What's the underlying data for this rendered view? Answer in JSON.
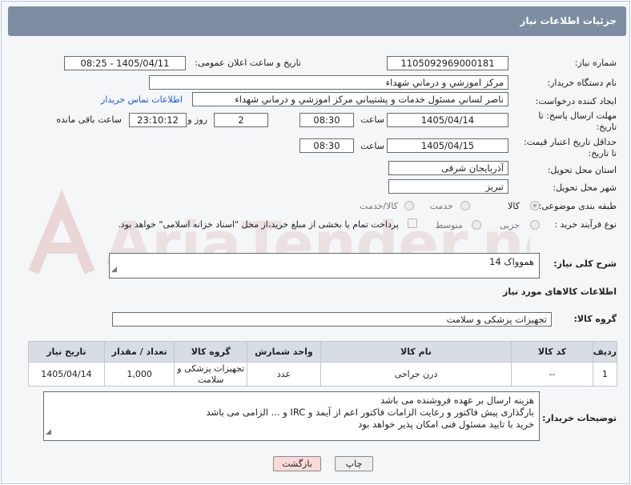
{
  "header": {
    "title": "جزئیات اطلاعات نیاز"
  },
  "form": {
    "need_number_label": "شماره نیاز:",
    "need_number": "1105092969000181",
    "announce_label": "تاریخ و ساعت اعلان عمومی:",
    "announce_value": "1405/04/11 - 08:25",
    "buyer_org_label": "نام دستگاه خریدار:",
    "buyer_org": "مرکز اموزشي و درماني شهداء",
    "requester_label": "ایجاد کننده درخواست:",
    "requester": "ناصر لساني مسئول خدمات و پشتيباني مرکز اموزشي و درماني شهداء",
    "contact_link": "اطلاعات تماس خریدار",
    "deadline_label_1": "مهلت ارسال پاسخ: تا",
    "deadline_label_2": "تاریخ:",
    "deadline_date": "1405/04/14",
    "hour_label": "ساعت",
    "deadline_time": "08:30",
    "days_value": "2",
    "days_label": "روز و",
    "remaining_time": "23:10:12",
    "remaining_label": "ساعت باقی مانده",
    "validity_label_1": "حداقل تاریخ اعتبار قیمت:",
    "validity_label_2": "تا تاریخ:",
    "validity_date": "1405/04/15",
    "validity_time": "08:30",
    "province_label": "استان محل تحویل:",
    "province": "آذربایجان شرقی",
    "city_label": "شهر محل تحویل:",
    "city": "تبریز",
    "category_label": "طبقه بندی موضوعی:",
    "category_options": [
      "کالا",
      "خدمت",
      "کالا/خدمت"
    ],
    "process_label": "نوع فرآیند خرید :",
    "process_options": [
      "جزیی",
      "متوسط"
    ],
    "payment_note": "پرداخت تمام یا بخشی از مبلغ خرید،از محل \"اسناد خزانه اسلامی\" خواهد بود.",
    "summary_label": "شرح کلی نیاز:",
    "summary": "هموواک 14",
    "items_section_label": "اطلاعات کالاهای مورد نیاز",
    "goods_group_label": "گروه کالا:",
    "goods_group": "تجهیزات پزشکی و سلامت"
  },
  "table": {
    "columns": [
      "ردیف",
      "کد کالا",
      "نام کالا",
      "واحد شمارش",
      "گروه کالا",
      "تعداد / مقدار",
      "تاریخ نیاز"
    ],
    "rows": [
      [
        "1",
        "--",
        "درن جراحی",
        "عدد",
        "تجهیزات پزشکی و سلامت",
        "1,000",
        "1405/04/14"
      ]
    ]
  },
  "buyer_notes": {
    "label": "توضیحات خریدار:",
    "line1": "هزینه ارسال بر عهده فروشنده می باشد",
    "line2": "بارگذاری پیش فاکتور و رعایت الزامات فاکتور اعم از آیمد و IRC  و ... الزامی می باشد",
    "line3": "خرید با تایید مسئول فنی امکان پذیر خواهد بود"
  },
  "buttons": {
    "print": "چاپ",
    "back": "بازگشت"
  },
  "watermark": {
    "text": "AriaTender.neT"
  },
  "colors": {
    "header_bg": "#7d8ea3",
    "link": "#1a5cc8",
    "back_button_bg": "#f9d9d9",
    "table_header_bg": "#d8dde3"
  }
}
